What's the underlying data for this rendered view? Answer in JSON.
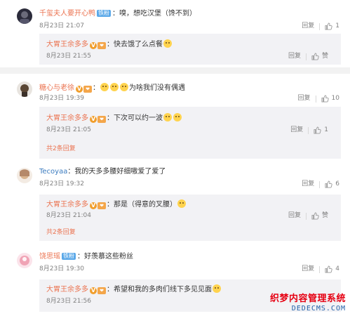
{
  "comments": [
    {
      "user": "千玺夫人要开心鸭",
      "badge": "铁粉",
      "text": "：嗅，想吃汉堡（馋不到）",
      "time": "8月23日 21:07",
      "reply_label": "回复",
      "likes": "1",
      "avatar_color": "#2b2b3a",
      "reply": {
        "user": "大胃王余多多",
        "text": "：快去饿了么点餐",
        "time": "8月23日 21:55",
        "reply_label": "回复",
        "likes": "赞"
      }
    },
    {
      "user": "糖心与老徐",
      "text": "为啥我们没有偶遇",
      "time": "8月23日 19:39",
      "reply_label": "回复",
      "likes": "10",
      "avatar_color": "#5a4634",
      "reply": {
        "user": "大胃王余多多",
        "text": "：下次可以约一波",
        "time": "8月23日 21:05",
        "reply_label": "回复",
        "likes": "1"
      },
      "more_label": "共2条回复"
    },
    {
      "user": "Tecoyaa",
      "text": "：我的天多多腰好细嗷爱了爱了",
      "time": "8月23日 19:32",
      "reply_label": "回复",
      "likes": "6",
      "avatar_color": "#d9b48f",
      "reply": {
        "user": "大胃王余多多",
        "text": "：那是（得意的叉腰）",
        "time": "8月23日 21:04",
        "reply_label": "回复",
        "likes": "赞"
      },
      "more_label": "共2条回复"
    },
    {
      "user": "饶思瑶",
      "badge": "铁粉",
      "text": "：好羡慕这些粉丝",
      "time": "8月23日 19:30",
      "reply_label": "回复",
      "likes": "4",
      "avatar_color": "#f0a3b5",
      "reply": {
        "user": "大胃王余多多",
        "text": "：希望和我的多肉们线下多见见面",
        "time": "8月23日 21:56",
        "reply_label": "回复",
        "likes": "赞"
      }
    }
  ],
  "watermark": {
    "line1": "织梦内容管理系统",
    "line2": "DEDECMS.COM"
  },
  "colors": {
    "username": "#eb7350",
    "meta": "#808080",
    "reply_bg": "#f2f2f5",
    "divider": "#f2f2f2"
  },
  "icons": [
    "thumb-up-icon",
    "v-verified-icon",
    "rank-icon",
    "emoji-icon"
  ]
}
